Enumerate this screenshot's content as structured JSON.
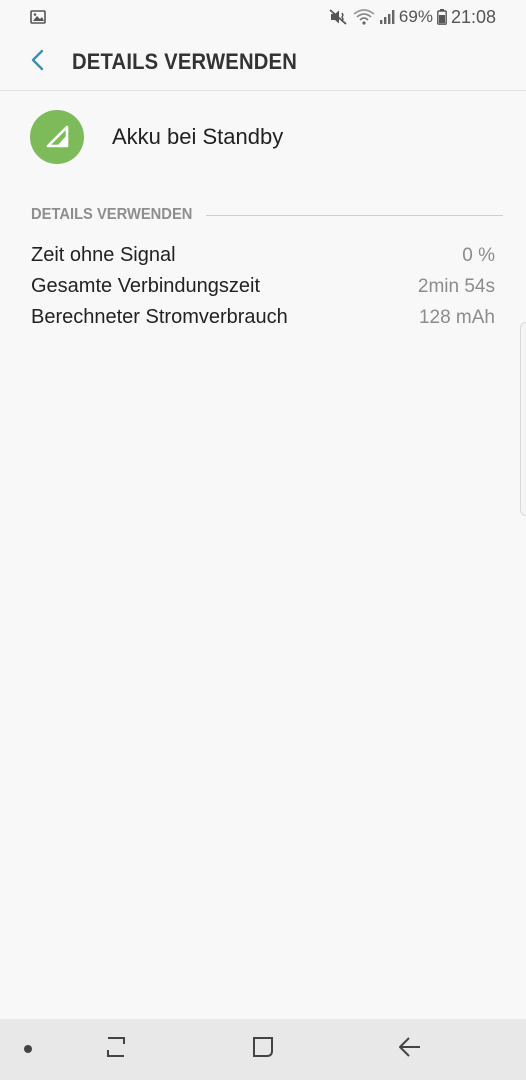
{
  "status_bar": {
    "battery_percent": "69%",
    "time": "21:08",
    "icons": [
      "image-notification-icon",
      "mute-vibrate-icon",
      "wifi-icon",
      "signal-icon",
      "battery-icon"
    ]
  },
  "header": {
    "title": "DETAILS VERWENDEN",
    "back_icon": "chevron-left-icon"
  },
  "app": {
    "name": "Akku bei Standby",
    "icon": "cell-standby-icon",
    "icon_color": "#7dbb5a"
  },
  "details": {
    "section_title": "DETAILS VERWENDEN",
    "rows": [
      {
        "label": "Zeit ohne Signal",
        "value": "0 %"
      },
      {
        "label": "Gesamte Verbindungszeit",
        "value": "2min 54s"
      },
      {
        "label": "Berechneter Stromverbrauch",
        "value": "128 mAh"
      }
    ]
  },
  "navigation": {
    "items": [
      "dot-icon",
      "recent-apps-icon",
      "home-icon",
      "back-arrow-icon"
    ]
  },
  "colors": {
    "accent": "#3d8fb0",
    "background": "#f8f8f8",
    "navbar": "#e8e8e8"
  }
}
